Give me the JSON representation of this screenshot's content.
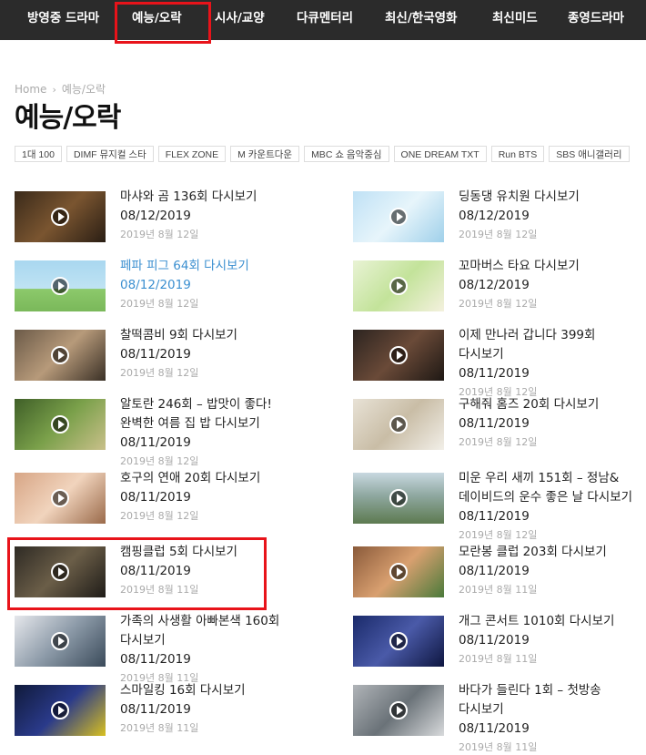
{
  "nav": {
    "items": [
      {
        "label": "방영중 드라마"
      },
      {
        "label": "예능/오락"
      },
      {
        "label": "시사/교양"
      },
      {
        "label": "다큐멘터리"
      },
      {
        "label": "최신/한국영화"
      },
      {
        "label": "최신미드"
      },
      {
        "label": "종영드라마"
      }
    ],
    "active": "예능/오락"
  },
  "breadcrumb": {
    "home": "Home",
    "separator": "›",
    "current": "예능/오락"
  },
  "page_title": "예능/오락",
  "tags": [
    "1대 100",
    "DIMF 뮤지컬 스타",
    "FLEX ZONE",
    "M 카운트다운",
    "MBC 쇼 음악중심",
    "ONE DREAM TXT",
    "Run BTS",
    "SBS 애니갤러리"
  ],
  "colors": {
    "nav_bg": "#2b2b2b",
    "highlight": "#e8131a",
    "link_active": "#3b8fd0",
    "meta": "#aaaaaa"
  },
  "posts": [
    {
      "title": "마샤와 곰 136회 다시보기",
      "date": "08/12/2019",
      "published": "2019년 8월 12일"
    },
    {
      "title": "딩동댕 유치원 다시보기",
      "date": "08/12/2019",
      "published": "2019년 8월 12일"
    },
    {
      "title": "페파 피그 64회 다시보기",
      "date": "08/12/2019",
      "published": "2019년 8월 12일"
    },
    {
      "title": "꼬마버스 타요 다시보기",
      "date": "08/12/2019",
      "published": "2019년 8월 12일"
    },
    {
      "title": "찰떡콤비 9회 다시보기",
      "date": "08/11/2019",
      "published": "2019년 8월 12일"
    },
    {
      "title": "이제 만나러 갑니다 399회 다시보기",
      "date": "08/11/2019",
      "published": "2019년 8월 12일"
    },
    {
      "title": "알토란 246회 – 밥맛이 좋다! 완벽한 여름 집 밥 다시보기",
      "date": "08/11/2019",
      "published": "2019년 8월 12일"
    },
    {
      "title": "구해줘 홈즈 20회 다시보기",
      "date": "08/11/2019",
      "published": "2019년 8월 12일"
    },
    {
      "title": "호구의 연애 20회 다시보기",
      "date": "08/11/2019",
      "published": "2019년 8월 12일"
    },
    {
      "title": "미운 우리 새끼 151회 – 정남&데이비드의 운수 좋은 날 다시보기",
      "date": "08/11/2019",
      "published": "2019년 8월 12일"
    },
    {
      "title": "캠핑클럽 5회 다시보기",
      "date": "08/11/2019",
      "published": "2019년 8월 11일"
    },
    {
      "title": "모란봉 클럽 203회 다시보기",
      "date": "08/11/2019",
      "published": "2019년 8월 11일"
    },
    {
      "title": "가족의 사생활 아빠본색 160회 다시보기",
      "date": "08/11/2019",
      "published": "2019년 8월 11일"
    },
    {
      "title": "개그 콘서트 1010회 다시보기",
      "date": "08/11/2019",
      "published": "2019년 8월 11일"
    },
    {
      "title": "스마일킹 16회 다시보기",
      "date": "08/11/2019",
      "published": "2019년 8월 11일"
    },
    {
      "title": "바다가 들린다 1회 – 첫방송 다시보기",
      "date": "08/11/2019",
      "published": "2019년 8월 11일"
    }
  ]
}
